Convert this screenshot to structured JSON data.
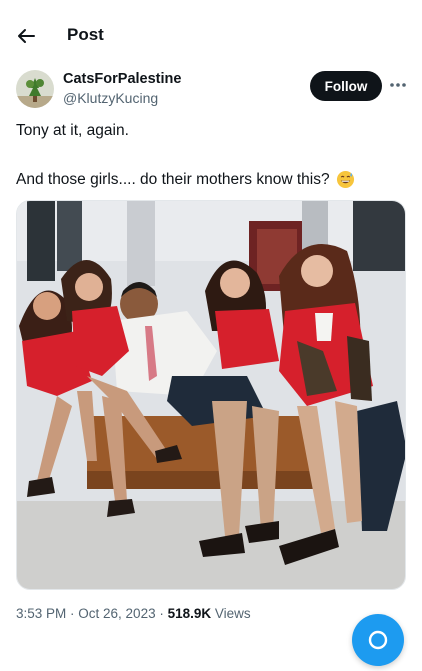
{
  "header": {
    "title": "Post",
    "back_icon": "arrow-left-icon"
  },
  "author": {
    "name": "CatsForPalestine",
    "handle": "@KlutzyKucing",
    "follow_label": "Follow",
    "more_icon": "more-horizontal-icon"
  },
  "post": {
    "line1": "Tony at it, again.",
    "line2": "And those girls.... do their mothers know this?",
    "emoji": "grinning-face-with-sweat-emoji"
  },
  "media": {
    "type": "photo"
  },
  "meta": {
    "time": "3:53 PM",
    "separator": " · ",
    "date": "Oct 26, 2023",
    "views_count": "518.9K",
    "views_label": " Views"
  },
  "colors": {
    "accent": "#1d9bf0",
    "text": "#0f1419",
    "secondary": "#536471",
    "flight_red": "#d6202c"
  }
}
